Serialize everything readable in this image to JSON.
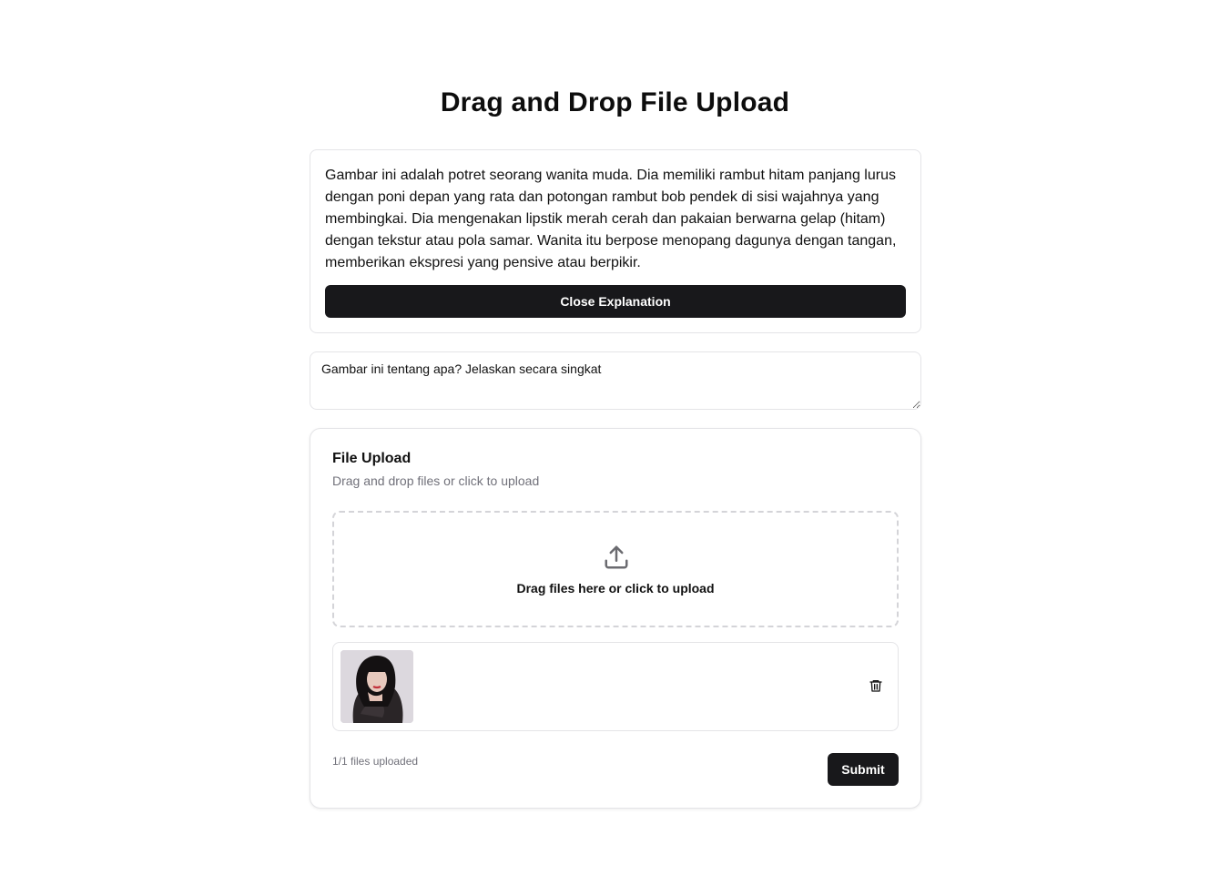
{
  "page": {
    "title": "Drag and Drop File Upload"
  },
  "explanation": {
    "text": "Gambar ini adalah potret seorang wanita muda. Dia memiliki rambut hitam panjang lurus dengan poni depan yang rata dan potongan rambut bob pendek di sisi wajahnya yang membingkai. Dia mengenakan lipstik merah cerah dan pakaian berwarna gelap (hitam) dengan tekstur atau pola samar. Wanita itu berpose menopang dagunya dengan tangan, memberikan ekspresi yang pensive atau berpikir.",
    "close_label": "Close Explanation"
  },
  "prompt": {
    "value": "Gambar ini tentang apa? Jelaskan secara singkat"
  },
  "upload": {
    "title": "File Upload",
    "subtitle": "Drag and drop files or click to upload",
    "dropzone_label": "Drag files here or click to upload",
    "status": "1/1 files uploaded",
    "submit_label": "Submit"
  },
  "icons": {
    "upload": "upload-icon",
    "delete": "trash-icon"
  },
  "colors": {
    "primary": "#18181b",
    "muted_text": "#71717a",
    "border": "#e4e4e7"
  }
}
